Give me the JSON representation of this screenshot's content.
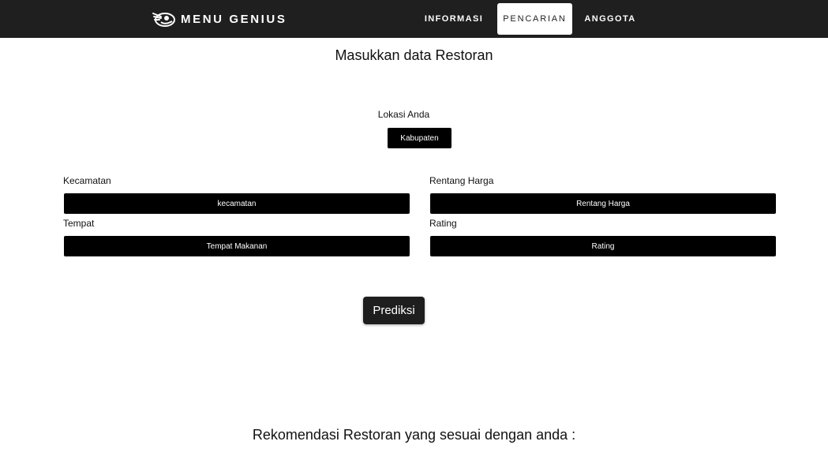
{
  "navbar": {
    "brand": "MENU GENIUS",
    "links": [
      {
        "label": "INFORMASI"
      },
      {
        "label": "PENCARIAN",
        "active": true
      },
      {
        "label": "ANGGOTA"
      }
    ]
  },
  "form": {
    "title": "Masukkan data Restoran",
    "location_label": "Lokasi Anda",
    "location_button": "Kabupaten",
    "kecamatan_label": "Kecamatan",
    "kecamatan_button": "kecamatan",
    "harga_label": "Rentang Harga",
    "harga_button": "Rentang Harga",
    "tempat_label": "Tempat",
    "tempat_button": "Tempat Makanan",
    "rating_label": "Rating",
    "rating_button": "Rating",
    "predict_button": "Prediksi"
  },
  "results": {
    "title": "Rekomendasi Restoran yang sesuai dengan anda :"
  },
  "colors": {
    "navbar_bg": "#1f1f1f",
    "button_bg": "#000000",
    "page_bg": "#ffffff"
  }
}
